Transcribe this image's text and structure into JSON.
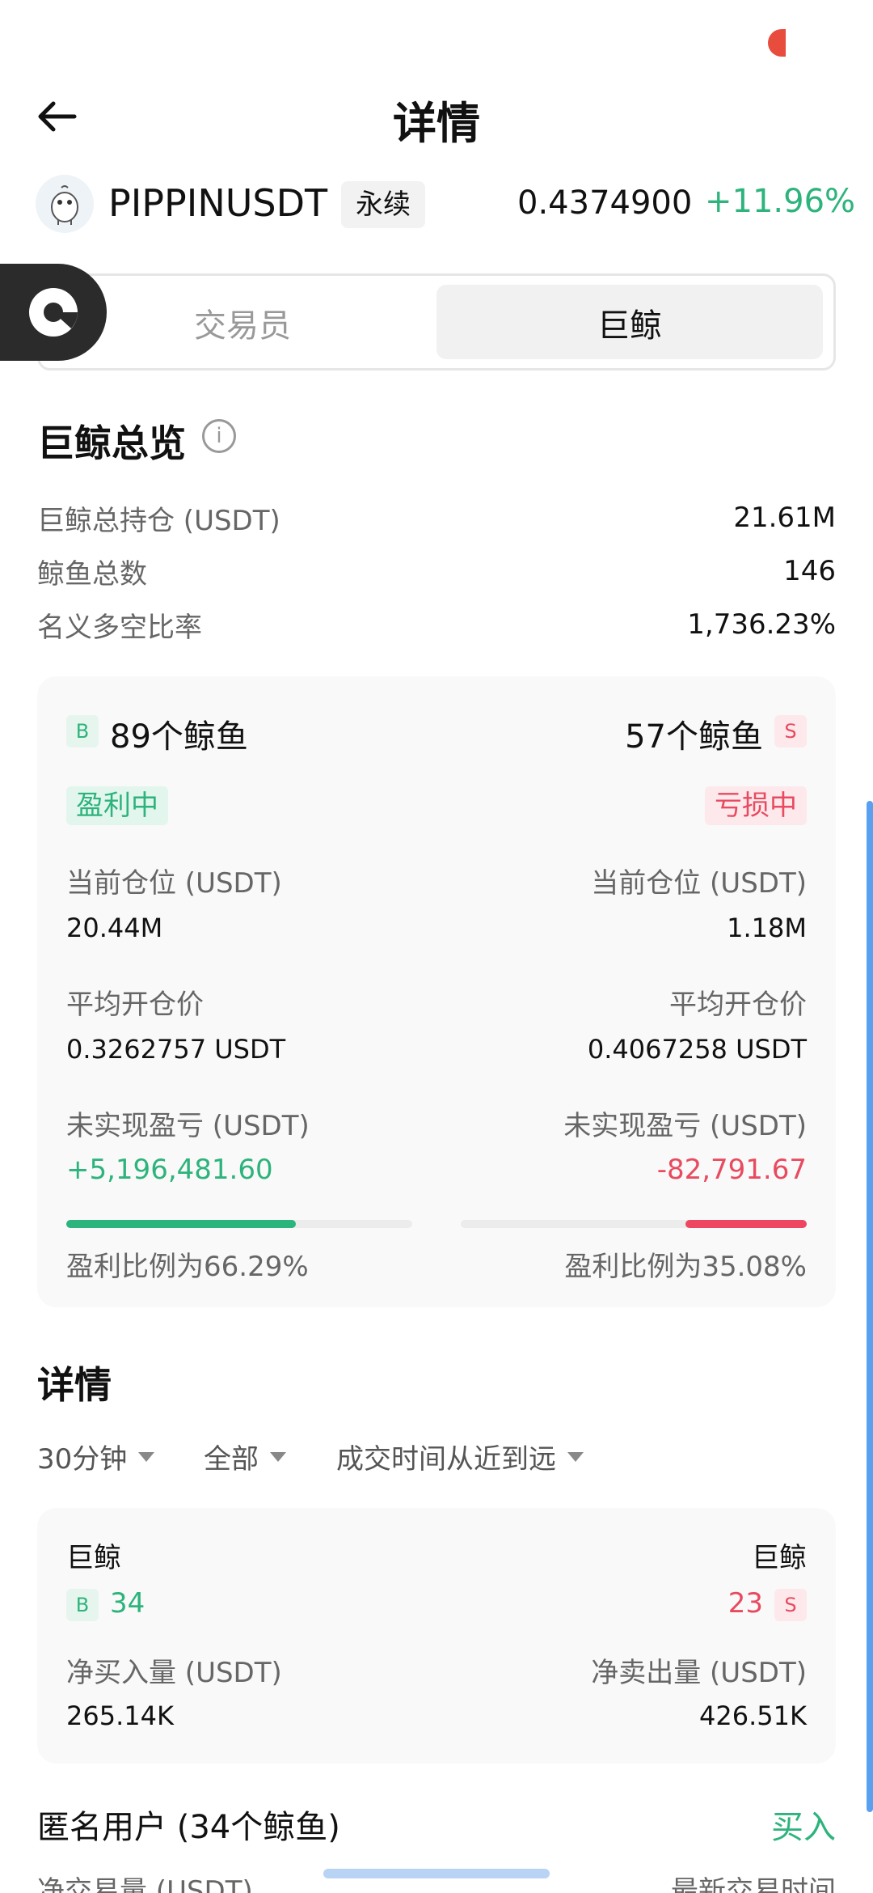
{
  "header": {
    "title": "详情"
  },
  "ticker": {
    "symbol": "PIPPINUSDT",
    "tag": "永续",
    "price": "0.4374900",
    "change": "+11.96%"
  },
  "tabs": [
    {
      "label": "交易员",
      "active": false
    },
    {
      "label": "巨鲸",
      "active": true
    }
  ],
  "overview": {
    "title": "巨鲸总览",
    "rows": [
      {
        "label": "巨鲸总持仓 (USDT)",
        "value": "21.61M"
      },
      {
        "label": "鲸鱼总数",
        "value": "146"
      },
      {
        "label": "名义多空比率",
        "value": "1,736.23%"
      }
    ]
  },
  "long": {
    "badge": "B",
    "count_label": "89个鲸鱼",
    "status": "盈利中",
    "position_label": "当前仓位 (USDT)",
    "position_value": "20.44M",
    "avg_price_label": "平均开仓价",
    "avg_price_value": "0.3262757 USDT",
    "pnl_label": "未实现盈亏 (USDT)",
    "pnl_value": "+5,196,481.60",
    "profit_ratio_text": "盈利比例为66.29%",
    "profit_ratio": 0.6629
  },
  "short": {
    "badge": "S",
    "count_label": "57个鲸鱼",
    "status": "亏损中",
    "position_label": "当前仓位 (USDT)",
    "position_value": "1.18M",
    "avg_price_label": "平均开仓价",
    "avg_price_value": "0.4067258 USDT",
    "pnl_label": "未实现盈亏 (USDT)",
    "pnl_value": "-82,791.67",
    "profit_ratio_text": "盈利比例为35.08%",
    "profit_ratio": 0.3508
  },
  "details": {
    "title": "详情",
    "filters": [
      {
        "label": "30分钟"
      },
      {
        "label": "全部"
      },
      {
        "label": "成交时间从近到远"
      }
    ],
    "summary": {
      "left_title": "巨鲸",
      "left_badge": "B",
      "left_count": "34",
      "right_title": "巨鲸",
      "right_badge": "S",
      "right_count": "23",
      "net_buy_label": "净买入量 (USDT)",
      "net_buy_value": "265.14K",
      "net_sell_label": "净卖出量 (USDT)",
      "net_sell_value": "426.51K"
    }
  },
  "anon": {
    "title": "匿名用户 (34个鲸鱼)",
    "buy_label": "买入",
    "col_left": "净交易量 (USDT)",
    "col_right": "最新交易时间"
  },
  "colors": {
    "green": "#2db37c",
    "red": "#e84a5f"
  },
  "icons": [
    "back-arrow-icon",
    "pepe-avatar-icon",
    "info-icon",
    "floating-assistant-icon",
    "caret-down-icon"
  ]
}
